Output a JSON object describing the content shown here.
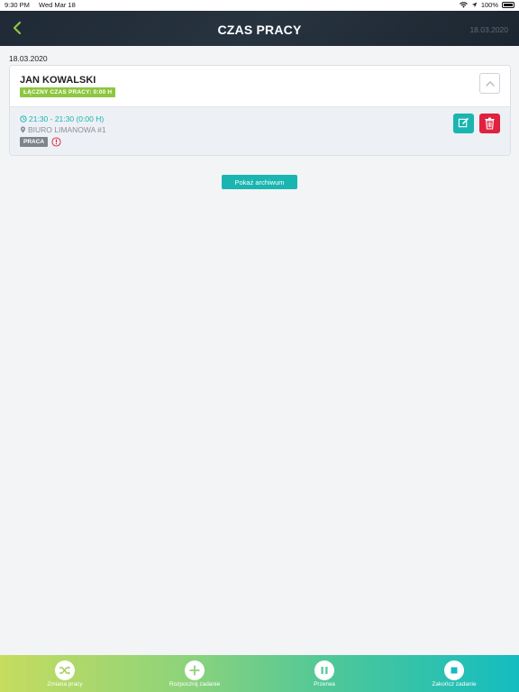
{
  "status_bar": {
    "time": "9:30 PM",
    "date": "Wed Mar 18",
    "battery": "100%"
  },
  "header": {
    "title": "CZAS PRACY",
    "date": "18.03.2020"
  },
  "day": {
    "date": "18.03.2020"
  },
  "employee": {
    "name": "JAN KOWALSKI",
    "total_label": "ŁĄCZNY CZAS PRACY: 0:00 H",
    "entry": {
      "time": "21:30 - 21:30 (0:00 H)",
      "location": "BIURO LIMANOWA #1",
      "type": "PRACA"
    }
  },
  "archive_button": "Pokaż archiwum",
  "tabs": [
    {
      "label": "Zmiana pracy",
      "icon": "shuffle-icon"
    },
    {
      "label": "Rozpocznij zadanie",
      "icon": "plus-icon"
    },
    {
      "label": "Przerwa",
      "icon": "pause-icon"
    },
    {
      "label": "Zakończ zadanie",
      "icon": "stop-icon"
    }
  ],
  "colors": {
    "accent": "#1ab5b0",
    "danger": "#e0213f",
    "total_badge": "#8dc63f",
    "type_badge": "#7d848c",
    "navbar": "#1f2a36"
  }
}
